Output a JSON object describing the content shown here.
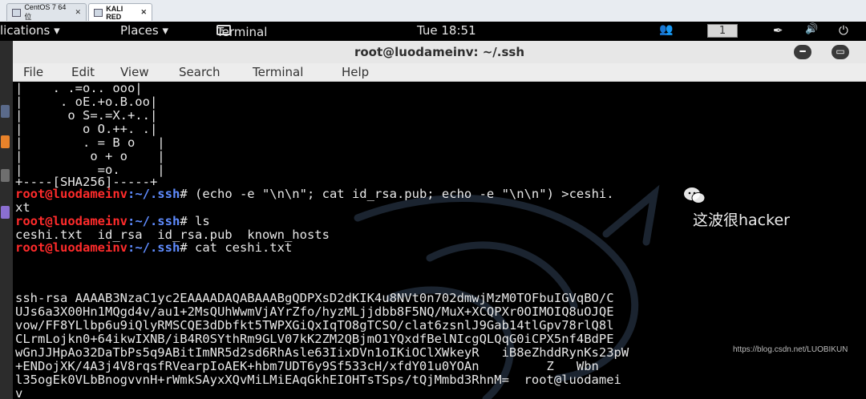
{
  "vm_tabs": [
    {
      "label": "CentOS 7 64 位",
      "active": false
    },
    {
      "label": "KALI RED",
      "active": true
    }
  ],
  "topbar": {
    "applications": "lications ▾",
    "places": "Places ▾",
    "terminal": "Terminal ▾",
    "clock": "Tue 18:51",
    "workspace": "1",
    "icons": [
      "people-icon",
      "pen-icon",
      "volume-icon",
      "power-icon"
    ]
  },
  "window": {
    "title": "root@luodameinv: ~/.ssh",
    "menu": [
      "File",
      "Edit",
      "View",
      "Search",
      "Terminal",
      "Help"
    ]
  },
  "terminal": {
    "art": [
      "|    . .=o.. ooo|",
      "|     . oE.+o.B.oo|",
      "|      o S=.=X.+..|",
      "|        o O.++. .|",
      "|        . = B o   |",
      "|         o + o    |",
      "|          =o.     |",
      "+----[SHA256]-----+"
    ],
    "prompt_user": "root@luodameinv",
    "prompt_path": ":~/.ssh",
    "prompt_hash": "#",
    "cmd1": " (echo -e \"\\n\\n\"; cat id_rsa.pub; echo -e \"\\n\\n\") >ceshi.",
    "cmd1_wrap": "xt",
    "cmd2": " ls",
    "ls_output": "ceshi.txt  id_rsa  id_rsa.pub  known_hosts",
    "cmd3": " cat ceshi.txt",
    "key_lines": [
      "ssh-rsa AAAAB3NzaC1yc2EAAAADAQABAAABgQDPXsD2dKIK4u8NVt0n702dmwjMzM0TOFbuIGVqBO/C",
      "UJs6a3X00Hn1MQgd4v/au1+2MsQUhWwmVjAYrZfo/hyzMLjjdbb8F5NQ/MuX+XCQPXr0OIMOIQ8uOJQE",
      "vow/FF8YLlbp6u9iQlyRMSCQE3dDbfkt5TWPXGiQxIqTO8gTCSO/clat6zsnlJ9Gab14tlGpv78rlQ8l",
      "CLrmLojkn0+64ikwIXNB/iB4R0SYthRm9GLV07kK2ZM2QBjmO1YQxdfBelNIcgQLQqG0iCPX5nf4BdPE",
      "wGnJJHpAo32DaTbPs5q9ABitImNR5d2sd6RhAsle63IixDVn1oIKiOClXWkeyR   iB8eZhddRynKs23pW",
      "+ENDojXK/4A3j4V8rqsfRVearpIoAEK+hbm7UDT6y9Sf533cH/xfdY01u0YOAn         Z   Wbn",
      "l35ogEk0VLbBnogvvnH+rWmkSAyxXQvMiLMiEAqGkhEIOHTsTSps/tQjMmbd3RhnM=  root@luodamei",
      "v"
    ]
  },
  "watermark": {
    "text": "这波很hacker",
    "url": "https://blog.csdn.net/LUOBIKUN"
  },
  "colors": {
    "prompt_user": "#ff2b2b",
    "prompt_path": "#5f8cff",
    "text": "#e8e8e8",
    "terminal_bg": "#000000"
  }
}
